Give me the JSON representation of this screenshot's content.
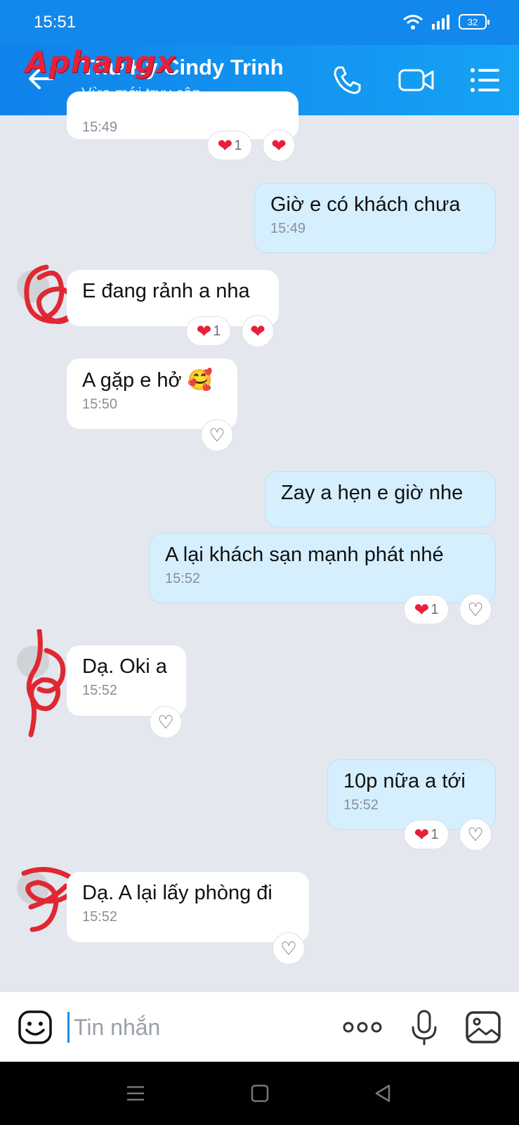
{
  "status_bar": {
    "time": "15:51",
    "battery": "32"
  },
  "header": {
    "watermark": "Aphangx",
    "contact_name": "Thư Ký Cindy Trinh",
    "contact_status": "Vừa mới truy cập"
  },
  "messages": [
    {
      "from": "them",
      "text": "",
      "time": "15:49",
      "reactions": {
        "heart_count": "1"
      }
    },
    {
      "from": "me",
      "text": "Giờ e có khách chưa",
      "time": "15:49"
    },
    {
      "from": "them",
      "text": "E đang rảnh a nha",
      "time": "",
      "reactions": {
        "heart_count": "1"
      }
    },
    {
      "from": "them",
      "text": "A gặp e hở 🥰",
      "time": "15:50"
    },
    {
      "from": "me",
      "text": "Zay a hẹn e giờ nhe",
      "time": ""
    },
    {
      "from": "me",
      "text": "A lại khách sạn mạnh phát nhé",
      "time": "15:52",
      "reactions": {
        "heart_count": "1"
      }
    },
    {
      "from": "them",
      "text": "Dạ. Oki a",
      "time": "15:52"
    },
    {
      "from": "me",
      "text": "10p nữa a tới",
      "time": "15:52",
      "reactions": {
        "heart_count": "1"
      }
    },
    {
      "from": "them",
      "text": "Dạ. A lại lấy phòng đi",
      "time": "15:52"
    }
  ],
  "composer": {
    "placeholder": "Tin nhắn"
  },
  "icons": {
    "back": "back-arrow-icon",
    "call": "phone-icon",
    "video": "video-camera-icon",
    "menu": "list-menu-icon",
    "emoji": "sticker-emoji-icon",
    "more": "more-dots-icon",
    "mic": "microphone-icon",
    "image": "image-gallery-icon"
  },
  "colors": {
    "header": "#1388ec",
    "bubble_out": "#d5efff",
    "bubble_in": "#ffffff",
    "heart": "#e8203a"
  }
}
